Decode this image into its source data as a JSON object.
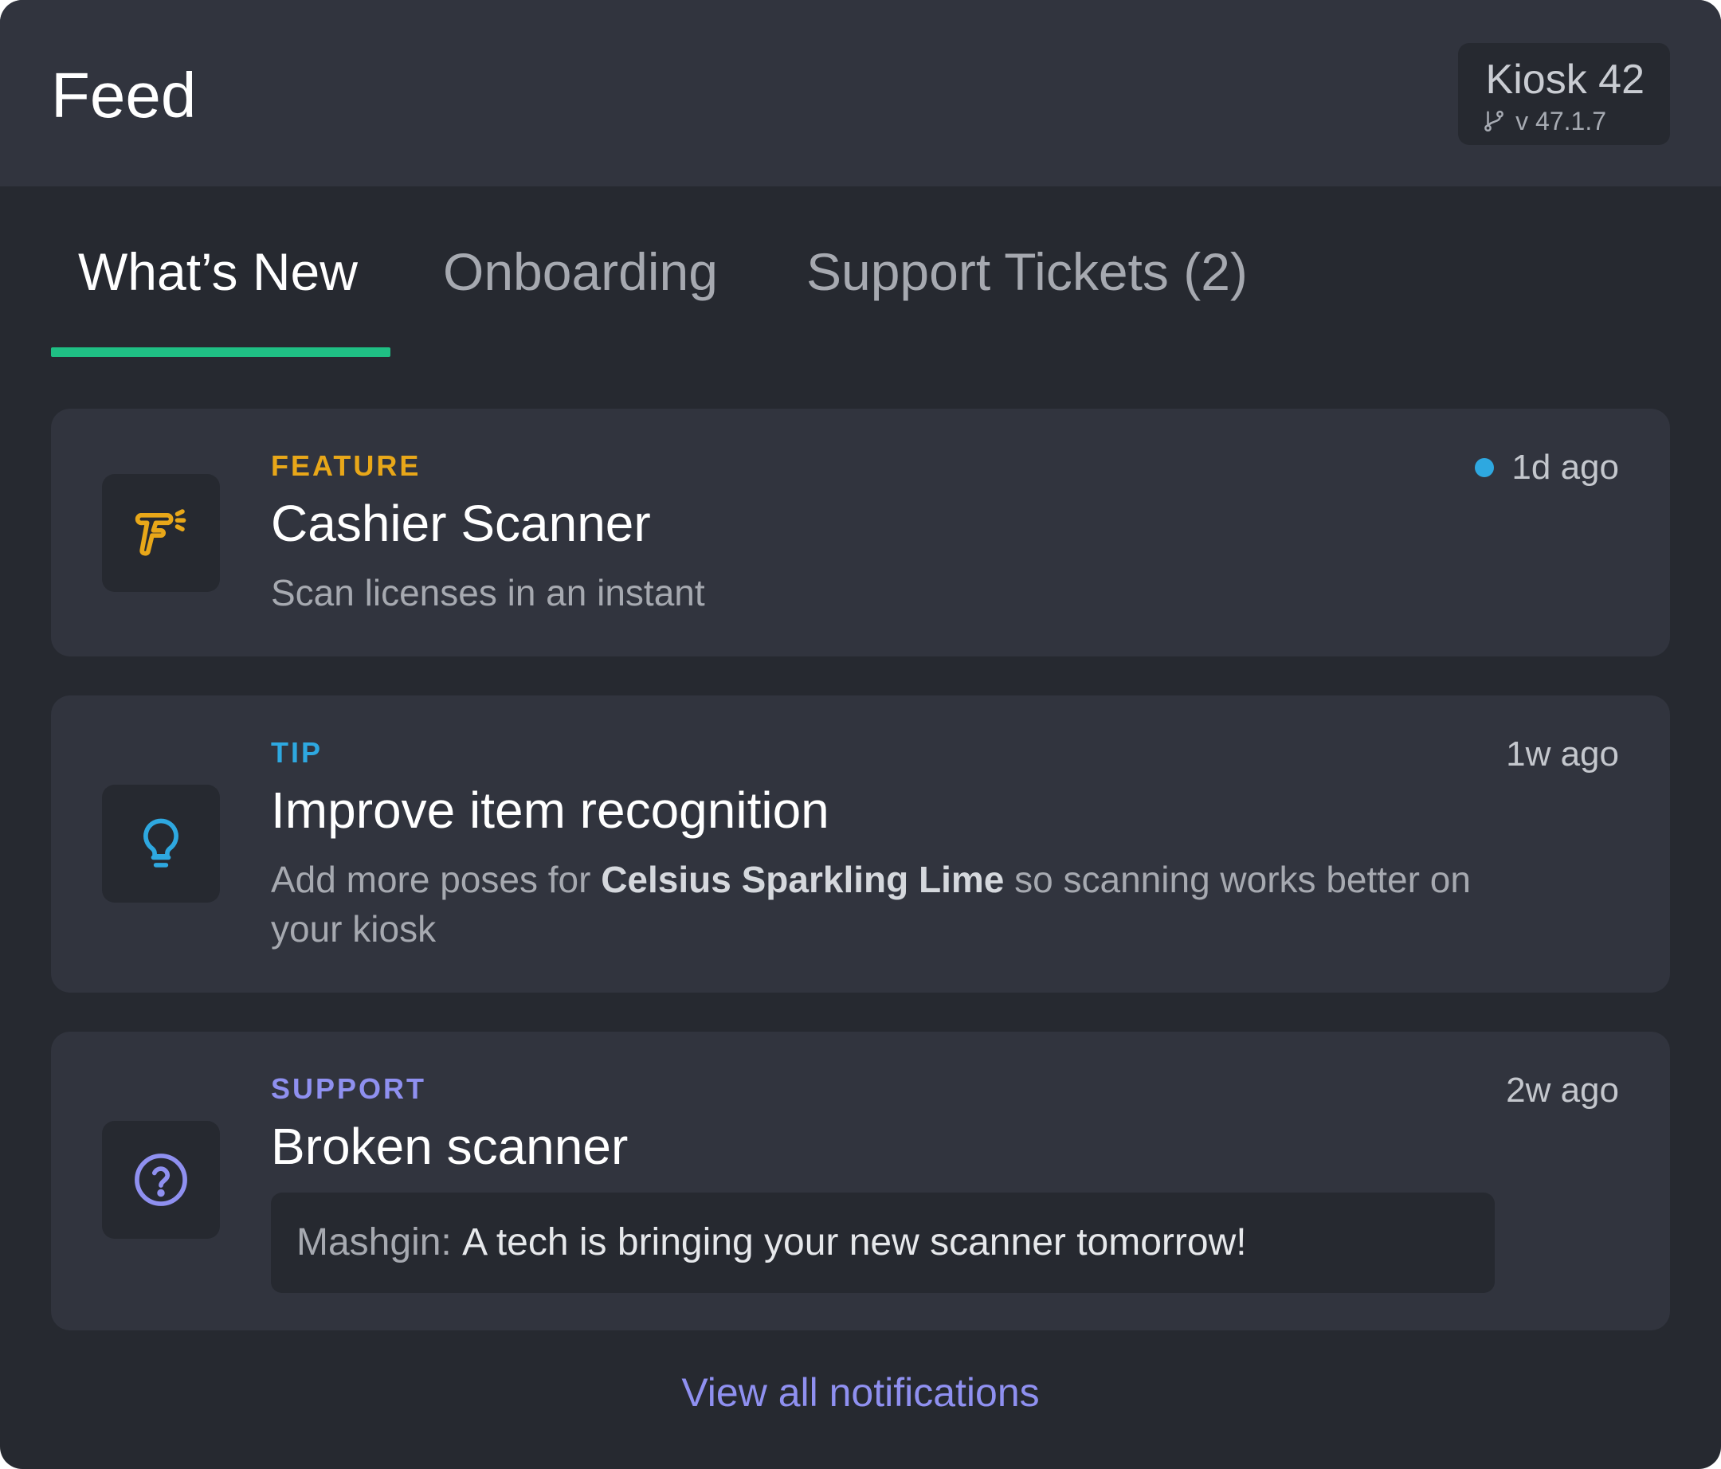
{
  "header": {
    "title": "Feed",
    "kiosk_name": "Kiosk 42",
    "version_label": "v 47.1.7"
  },
  "tabs": [
    {
      "label": "What’s New",
      "active": true
    },
    {
      "label": "Onboarding",
      "active": false
    },
    {
      "label": "Support Tickets (2)",
      "active": false
    }
  ],
  "feed": [
    {
      "category": "FEATURE",
      "category_color": "#e8a719",
      "icon": "scanner-icon",
      "title": "Cashier Scanner",
      "description": "Scan licenses in an instant",
      "time": "1d ago",
      "unread": true
    },
    {
      "category": "TIP",
      "category_color": "#2ea8e0",
      "icon": "lightbulb-icon",
      "title": "Improve item recognition",
      "description_prefix": "Add more poses for ",
      "description_bold": "Celsius Sparkling Lime",
      "description_suffix": " so scanning works better on your kiosk",
      "time": "1w ago",
      "unread": false
    },
    {
      "category": "SUPPORT",
      "category_color": "#8f90f0",
      "icon": "question-circle-icon",
      "title": "Broken scanner",
      "message_sender": "Mashgin:",
      "message_text": "A tech is bringing your new scanner tomorrow!",
      "time": "2w ago",
      "unread": false
    }
  ],
  "footer": {
    "link_label": "View all notifications"
  },
  "colors": {
    "accent_underline": "#1fbf84",
    "unread_dot": "#2ea8e0",
    "link": "#8f90f0"
  }
}
